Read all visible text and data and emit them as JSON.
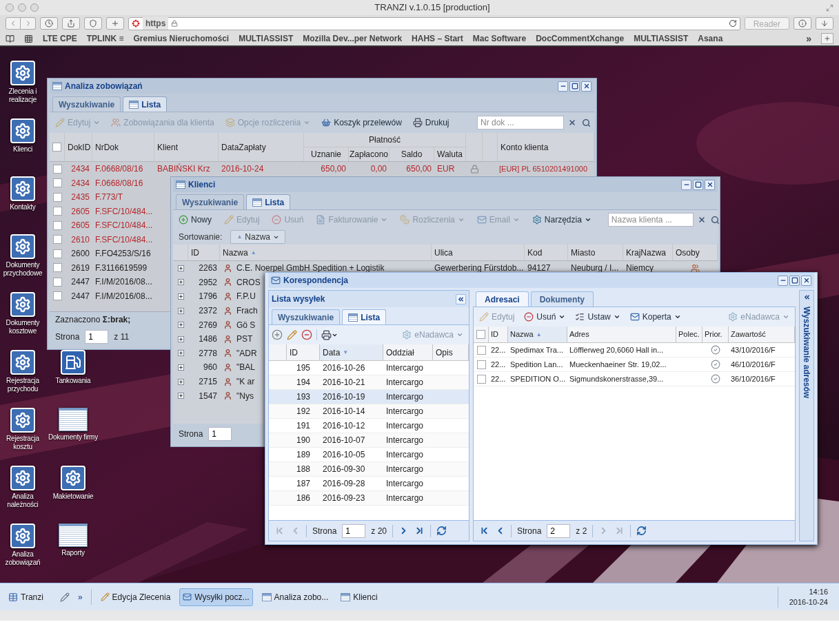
{
  "browser": {
    "title": "TRANZI v.1.0.15 [production]",
    "url": "https",
    "reader": "Reader",
    "bookmarks": [
      "LTE CPE",
      "TPLINK ≡",
      "Gremius Nieruchomości",
      "MULTIASSIST",
      "Mozilla Dev...per Network",
      "HAHS – Start",
      "Mac Software",
      "DocCommentXchange",
      "MULTIASSIST",
      "Asana"
    ],
    "overflow": "»"
  },
  "desktop": {
    "column_1": [
      {
        "label": "Zlecenia i realizacje",
        "kind": "gear"
      },
      {
        "label": "Klienci",
        "kind": "gear"
      },
      {
        "label": "Kontakty",
        "kind": "gear"
      },
      {
        "label": "Dokumenty przychodowe",
        "kind": "gear"
      },
      {
        "label": "Dokumenty kosztowe",
        "kind": "gear"
      },
      {
        "label": "Rejestracja przychodu",
        "kind": "gear"
      },
      {
        "label": "Rejestracja kosztu",
        "kind": "gear"
      },
      {
        "label": "Analiza należności",
        "kind": "gear"
      },
      {
        "label": "Analiza zobowiązań",
        "kind": "gear"
      }
    ],
    "column_2": [
      {
        "label": "Tankowania",
        "kind": "pump"
      },
      {
        "label": "Dokumenty firmy",
        "kind": "table"
      },
      {
        "label": "Makietowanie",
        "kind": "gear"
      },
      {
        "label": "Raporty",
        "kind": "table"
      }
    ]
  },
  "analiza": {
    "title": "Analiza zobowiązań",
    "tabs": [
      {
        "label": "Wyszukiwanie",
        "kind": "search",
        "selected": false
      },
      {
        "label": "Lista",
        "kind": "list",
        "selected": true
      }
    ],
    "toolbar": [
      {
        "label": "Edytuj",
        "disabled": true,
        "menu": true
      },
      {
        "label": "Zobowiązania dla klienta",
        "disabled": true,
        "menu": false
      },
      {
        "label": "Opcje rozliczenia",
        "disabled": true,
        "menu": true
      },
      {
        "label": "Koszyk przelewów",
        "disabled": false,
        "menu": false
      },
      {
        "label": "Drukuj",
        "disabled": false,
        "menu": false
      }
    ],
    "search": {
      "placeholder": "Nr dok ..."
    },
    "header_checked": false,
    "columns": [
      "DokID",
      "NrDok",
      "Klient",
      "DataZapłaty",
      "Konto klienta"
    ],
    "group": {
      "label": "Płatność",
      "columns": [
        "Uznanie",
        "Zapłacono",
        "Saldo",
        "Waluta"
      ]
    },
    "rows": [
      {
        "dok_id": "2434",
        "nr_dok": "F.0668/08/16",
        "checked": false,
        "overdue": true,
        "klient": "BABIŃSKI Krz",
        "data": "2016-10-24",
        "uznanie": "650,00",
        "zaplacono": "0,00",
        "saldo": "650,00",
        "waluta": "EUR",
        "locked": true,
        "konto": "[EUR] PL 6510201491000"
      },
      {
        "dok_id": "2434",
        "nr_dok": "F.0668/08/16",
        "checked": false,
        "overdue": true
      },
      {
        "dok_id": "2435",
        "nr_dok": "F.773/T",
        "checked": false,
        "overdue": true
      },
      {
        "dok_id": "2605",
        "nr_dok": "F.SFC/10/484...",
        "checked": false,
        "overdue": true
      },
      {
        "dok_id": "2605",
        "nr_dok": "F.SFC/10/484...",
        "checked": false,
        "overdue": true
      },
      {
        "dok_id": "2610",
        "nr_dok": "F.SFC/10/484...",
        "checked": false,
        "overdue": true
      },
      {
        "dok_id": "2600",
        "nr_dok": "F.FO4253/S/16",
        "checked": false,
        "overdue": false
      },
      {
        "dok_id": "2619",
        "nr_dok": "F.3116619599",
        "checked": false,
        "overdue": false
      },
      {
        "dok_id": "2447",
        "nr_dok": "F.I/M/2016/08...",
        "checked": false,
        "overdue": false
      },
      {
        "dok_id": "2447",
        "nr_dok": "F.I/M/2016/08...",
        "checked": false,
        "overdue": false
      }
    ],
    "selection": "Zaznaczono **Σ:brak;**",
    "pager": {
      "label": "Strona",
      "page": "1",
      "of": "z 11"
    }
  },
  "klienci": {
    "title": "Klienci",
    "tabs": [
      {
        "label": "Wyszukiwanie",
        "kind": "search",
        "selected": false
      },
      {
        "label": "Lista",
        "kind": "list",
        "selected": true
      }
    ],
    "toolbar": [
      {
        "label": "Nowy",
        "disabled": false,
        "menu": false
      },
      {
        "label": "Edytuj",
        "disabled": true,
        "menu": false
      },
      {
        "label": "Usuń",
        "disabled": true,
        "menu": false
      },
      {
        "label": "Fakturowanie",
        "disabled": true,
        "menu": true
      },
      {
        "label": "Rozliczenia",
        "disabled": true,
        "menu": true
      },
      {
        "label": "Email",
        "disabled": true,
        "menu": true
      },
      {
        "label": "Narzędzia",
        "disabled": false,
        "menu": true
      }
    ],
    "search": {
      "placeholder": "Nazwa klienta ..."
    },
    "sort": {
      "label": "Sortowanie:",
      "field": "Nazwa",
      "arrow": "▲"
    },
    "columns": [
      {
        "label": "ID"
      },
      {
        "label": "Nazwa",
        "sort_arrow": "▲"
      },
      {
        "label": "Ulica"
      },
      {
        "label": "Kod"
      },
      {
        "label": "Miasto"
      },
      {
        "label": "KrajNazwa"
      },
      {
        "label": "Osoby"
      }
    ],
    "rows": [
      {
        "id": "2263",
        "name": "C.E. Noerpel GmbH Spedition + Logistik",
        "street": "Gewerbering Fürstdob...",
        "code": "94127",
        "city": "Neuburg / I...",
        "country": "Niemcy",
        "persons": true
      },
      {
        "id": "2952",
        "name": "CROS"
      },
      {
        "id": "1796",
        "name": "F.P.U"
      },
      {
        "id": "2372",
        "name": "Frach"
      },
      {
        "id": "2769",
        "name": "Gö S"
      },
      {
        "id": "1486",
        "name": "PST"
      },
      {
        "id": "2778",
        "name": "\"ADR"
      },
      {
        "id": "960",
        "name": "\"BAL"
      },
      {
        "id": "2715",
        "name": "\"K ar"
      },
      {
        "id": "1547",
        "name": "\"Nys"
      }
    ],
    "pager": {
      "label": "Strona",
      "page": "1"
    }
  },
  "korespondencja": {
    "title": "Korespondencja",
    "left": {
      "title": "Lista wysyłek",
      "tabs": [
        {
          "label": "Wyszukiwanie",
          "kind": "search",
          "selected": false
        },
        {
          "label": "Lista",
          "kind": "list",
          "selected": true
        }
      ],
      "enadawca": {
        "label": "eNadawca",
        "disabled": true,
        "menu": true
      },
      "columns": [
        {
          "label": "ID"
        },
        {
          "label": "Data",
          "sort_arrow": "▼"
        },
        {
          "label": "Oddział"
        },
        {
          "label": "Opis"
        }
      ],
      "rows": [
        {
          "id": "195",
          "date": "2016-10-26",
          "branch": "Intercargo",
          "selected": false
        },
        {
          "id": "194",
          "date": "2016-10-21",
          "branch": "Intercargo",
          "selected": false
        },
        {
          "id": "193",
          "date": "2016-10-19",
          "branch": "Intercargo",
          "selected": true
        },
        {
          "id": "192",
          "date": "2016-10-14",
          "branch": "Intercargo",
          "selected": false
        },
        {
          "id": "191",
          "date": "2016-10-12",
          "branch": "Intercargo",
          "selected": false
        },
        {
          "id": "190",
          "date": "2016-10-07",
          "branch": "Intercargo",
          "selected": false
        },
        {
          "id": "189",
          "date": "2016-10-05",
          "branch": "Intercargo",
          "selected": false
        },
        {
          "id": "188",
          "date": "2016-09-30",
          "branch": "Intercargo",
          "selected": false
        },
        {
          "id": "187",
          "date": "2016-09-28",
          "branch": "Intercargo",
          "selected": false
        },
        {
          "id": "186",
          "date": "2016-09-23",
          "branch": "Intercargo",
          "selected": false
        }
      ],
      "pager": {
        "label": "Strona",
        "page": "1",
        "of": "z 20",
        "can_back": false,
        "can_forward": true
      }
    },
    "right": {
      "tabs": [
        {
          "label": "Adresaci",
          "selected": true
        },
        {
          "label": "Dokumenty",
          "selected": false
        }
      ],
      "toolbar": [
        {
          "label": "Edytuj",
          "disabled": true,
          "menu": false
        },
        {
          "label": "Usuń",
          "disabled": false,
          "menu": true
        },
        {
          "label": "Ustaw",
          "disabled": false,
          "menu": true
        },
        {
          "label": "Koperta",
          "disabled": false,
          "menu": true
        },
        {
          "label": "eNadawca",
          "disabled": true,
          "menu": true
        }
      ],
      "header_checked": false,
      "columns": [
        {
          "label": "ID"
        },
        {
          "label": "Nazwa",
          "sort_arrow": "▲"
        },
        {
          "label": "Adres"
        },
        {
          "label": "Polec."
        },
        {
          "label": "Prior."
        },
        {
          "label": "Zawartość"
        }
      ],
      "rows": [
        {
          "checked": false,
          "id": "22...",
          "name": "Spedimax Tra...",
          "address": "Löfflerweg 20,6060 Hall in...",
          "priority": true,
          "content": "43/10/2016/F"
        },
        {
          "checked": false,
          "id": "22...",
          "name": "Spedition Lan...",
          "address": "Mueckenhaeiner Str. 19,02...",
          "priority": true,
          "content": "46/10/2016/F"
        },
        {
          "checked": false,
          "id": "22...",
          "name": "SPEDITION O...",
          "address": "Sigmundskonerstrasse,39...",
          "priority": true,
          "content": "36/10/2016/F"
        }
      ],
      "pager": {
        "label": "Strona",
        "page": "2",
        "of": "z 2",
        "can_back": true,
        "can_forward": false
      }
    },
    "side_panel": "Wyszukiwanie adresów"
  },
  "taskbar": {
    "start": "Tranzi",
    "overflow": "»",
    "tasks": [
      {
        "label": "Edycja Zlecenia",
        "kind": "edit",
        "selected": false
      },
      {
        "label": "Wysyłki pocz...",
        "kind": "mail",
        "selected": true
      },
      {
        "label": "Analiza zobo...",
        "kind": "table",
        "selected": false
      },
      {
        "label": "Klienci",
        "kind": "table",
        "selected": false
      }
    ],
    "time": "14:16",
    "date": "2016-10-24"
  }
}
